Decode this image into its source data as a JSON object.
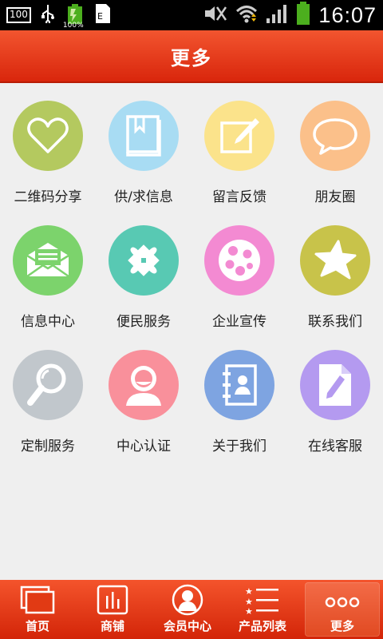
{
  "status_bar": {
    "badge": "100",
    "battery_percent": "100%",
    "time": "16:07"
  },
  "header": {
    "title": "更多"
  },
  "grid": {
    "items": [
      {
        "label": "二维码分享",
        "icon": "heart-icon",
        "color": "#b4c95f"
      },
      {
        "label": "供/求信息",
        "icon": "book-icon",
        "color": "#a8dcf3"
      },
      {
        "label": "留言反馈",
        "icon": "note-edit-icon",
        "color": "#fbe38b"
      },
      {
        "label": "朋友圈",
        "icon": "speech-bubble-icon",
        "color": "#fbc08a"
      },
      {
        "label": "信息中心",
        "icon": "envelope-icon",
        "color": "#7cd36c"
      },
      {
        "label": "便民服务",
        "icon": "puzzle-icon",
        "color": "#58c9b3"
      },
      {
        "label": "企业宣传",
        "icon": "film-reel-icon",
        "color": "#f38ad2"
      },
      {
        "label": "联系我们",
        "icon": "star-icon",
        "color": "#c8c34a"
      },
      {
        "label": "定制服务",
        "icon": "magnifier-icon",
        "color": "#c1c7cc"
      },
      {
        "label": "中心认证",
        "icon": "user-icon",
        "color": "#f9909b"
      },
      {
        "label": "关于我们",
        "icon": "contacts-book-icon",
        "color": "#7ea4e1"
      },
      {
        "label": "在线客服",
        "icon": "document-edit-icon",
        "color": "#b49af0"
      }
    ]
  },
  "bottom_nav": {
    "items": [
      {
        "label": "首页",
        "icon": "home-icon"
      },
      {
        "label": "商铺",
        "icon": "shop-icon"
      },
      {
        "label": "会员中心",
        "icon": "member-icon"
      },
      {
        "label": "产品列表",
        "icon": "list-icon"
      },
      {
        "label": "更多",
        "icon": "more-icon"
      }
    ],
    "active": "更多"
  },
  "colors": {
    "header_red": "#e33b17",
    "page_bg": "#efefef"
  }
}
